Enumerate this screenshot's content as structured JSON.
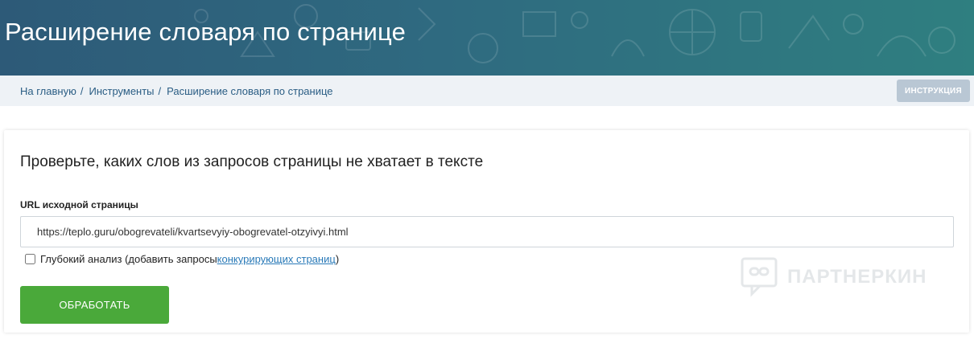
{
  "header": {
    "title": "Расширение словаря по странице"
  },
  "breadcrumb": {
    "items": [
      "На главную",
      "Инструменты",
      "Расширение словаря по странице"
    ],
    "separator": "/"
  },
  "instruction_button": {
    "label": "ИНСТРУКЦИЯ"
  },
  "form": {
    "heading": "Проверьте, каких слов из запросов страницы не хватает в тексте",
    "url_label": "URL исходной страницы",
    "url_value": "https://teplo.guru/obogrevateli/kvartsevyiy-obogrevatel-otzyivyi.html",
    "deep_analysis": {
      "checked": false,
      "label_prefix": "Глубокий анализ (добавить запросы ",
      "link_text": "конкурирующих страниц",
      "label_suffix": ")"
    },
    "submit_label": "ОБРАБОТАТЬ"
  },
  "watermark": {
    "text": "ПАРТНЕРКИН"
  },
  "colors": {
    "header_bg": "#2f6a80",
    "crumb_bg": "#eef2f6",
    "link": "#2a5d84",
    "submit": "#4aa93a",
    "instruction_btn": "#b9c7d4"
  }
}
